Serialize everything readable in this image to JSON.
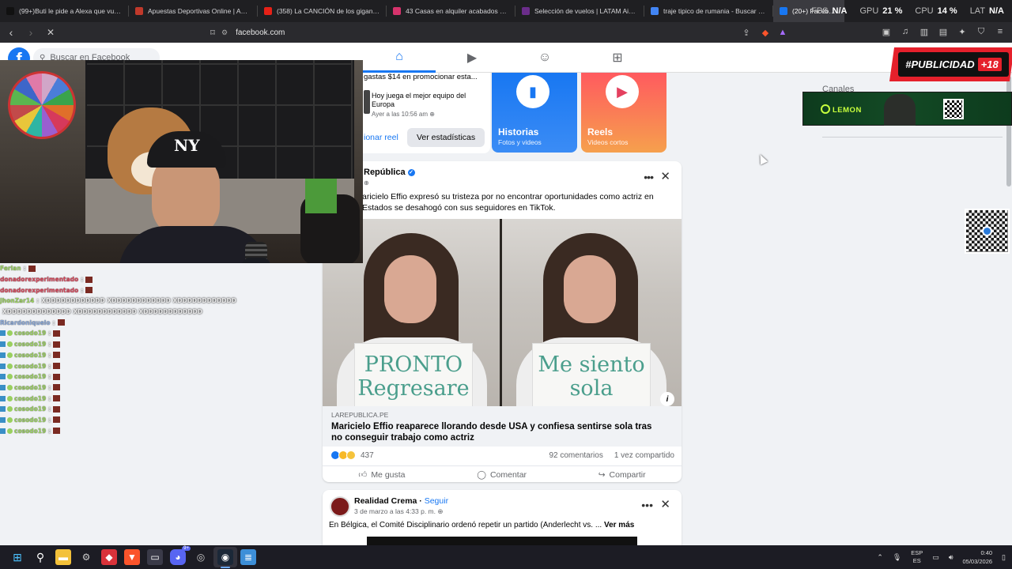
{
  "browser": {
    "tabs": [
      {
        "title": "(99+)Buti le pide a Alexa que vuelva",
        "favicon": "tiktok-icon",
        "color": "#111111"
      },
      {
        "title": "Apuestas Deportivas Online | Apuest",
        "favicon": "betting-icon",
        "color": "#c0392b"
      },
      {
        "title": "(358) La CANCIÓN de los gigantes d",
        "favicon": "youtube-icon",
        "color": "#e62117"
      },
      {
        "title": "43 Casas en alquiler acabados de luj",
        "favicon": "listing-icon",
        "color": "#d6336c"
      },
      {
        "title": "Selección de vuelos | LATAM Airlines",
        "favicon": "latam-icon",
        "color": "#6b2d8a"
      },
      {
        "title": "traje tipico de rumania - Buscar con",
        "favicon": "google-icon",
        "color": "#4285f4"
      },
      {
        "title": "(20+) Facebook",
        "favicon": "facebook-icon",
        "color": "#1877f2",
        "active": true
      }
    ],
    "url": "facebook.com"
  },
  "overlay_stats": [
    {
      "key": "FPS",
      "value": "N/A"
    },
    {
      "key": "GPU",
      "value": "21 %"
    },
    {
      "key": "CPU",
      "value": "14 %"
    },
    {
      "key": "LAT",
      "value": "N/A"
    }
  ],
  "facebook": {
    "search_placeholder": "Buscar en Facebook",
    "nav": [
      "home-icon",
      "video-icon",
      "groups-icon",
      "gaming-icon"
    ],
    "promo": {
      "spent_text": "gastas $14 en promocionar esta...",
      "post_text": "Hoy juega el mejor equipo del Europa",
      "time": "Ayer a las 10:56 am",
      "promote_reel": "ionar reel",
      "view_stats": "Ver estadísticas"
    },
    "stories": [
      {
        "title": "Historias",
        "subtitle": "Fotos y videos",
        "color_from": "#1877f2",
        "color_to": "#3b8cf5"
      },
      {
        "title": "Reels",
        "subtitle": "Videos cortos",
        "color_from": "#ff5a5f",
        "color_to": "#f6a04d"
      }
    ],
    "post": {
      "source": "República",
      "body": "aricielo Effio expresó su tristeza por no encontrar oportunidades como actriz en Estados se desahogó con sus seguidores en TikTok.",
      "sign_left": "PRONTO Regresare",
      "sign_right": "Me siento sola",
      "domain": "LAREPUBLICA.PE",
      "headline": "Maricielo Effio reaparece llorando desde USA y confiesa sentirse sola tras no conseguir trabajo como actriz",
      "reactions_count": "437",
      "comments": "92 comentarios",
      "shares": "1 vez compartido",
      "like": "Me gusta",
      "comment": "Comentar",
      "share": "Compartir"
    },
    "post2": {
      "author": "Realidad Crema",
      "follow": "Seguir",
      "time": "3 de marzo a las 4:33 p. m.",
      "body": "En Bélgica, el Comité Disciplinario ordenó repetir un partido (Anderlecht vs. ...",
      "more": "Ver más"
    },
    "right_column_label": "Canales"
  },
  "stream": {
    "ad_banner": "#PUBLICIDAD",
    "ad_rating": "+18",
    "sponsor": "LEMON",
    "chat": [
      {
        "user": "Ferlan",
        "msg": "",
        "color": "green"
      },
      {
        "user": "donadorexperimentado",
        "msg": "",
        "color": "red"
      },
      {
        "user": "donadorexperimentado",
        "msg": "",
        "color": "red"
      },
      {
        "user": "JhonZar14",
        "msg": "XDDDDDDDDDDDD XDDDDDDDDDDDD XDDDDDDDDDDDD",
        "color": "green"
      },
      {
        "user": "",
        "msg": "XDDDDDDDDDDDDD XDDDDDDDDDDDD XDDDDDDDDDDDD",
        "color": "green"
      },
      {
        "user": "Ricardoniquelo",
        "msg": "",
        "color": "blue"
      },
      {
        "user": "cosodo19",
        "msg": "",
        "color": "green"
      },
      {
        "user": "cosodo19",
        "msg": "",
        "color": "green"
      },
      {
        "user": "cosodo19",
        "msg": "",
        "color": "green"
      },
      {
        "user": "cosodo19",
        "msg": "",
        "color": "green"
      },
      {
        "user": "cosodo19",
        "msg": "",
        "color": "green"
      },
      {
        "user": "cosodo19",
        "msg": "",
        "color": "green"
      },
      {
        "user": "cosodo19",
        "msg": "",
        "color": "green"
      },
      {
        "user": "cosodo19",
        "msg": "",
        "color": "green"
      },
      {
        "user": "cosodo19",
        "msg": "",
        "color": "green"
      },
      {
        "user": "cosodo19",
        "msg": "",
        "color": "green"
      }
    ]
  },
  "taskbar": {
    "apps": [
      "windows-start-icon",
      "search-icon",
      "file-explorer-icon",
      "settings-icon",
      "app-red-icon",
      "brave-icon",
      "app-icon",
      "discord-icon",
      "app-circle-icon",
      "steam-icon",
      "notepad-icon"
    ],
    "discord_badge": "9+",
    "lang_top": "ESP",
    "lang_bottom": "ES",
    "time": "0:40",
    "date": "05/03/2026"
  }
}
